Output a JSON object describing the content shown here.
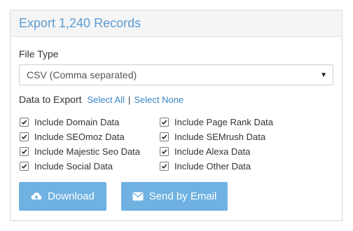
{
  "panel": {
    "title": "Export 1,240 Records"
  },
  "file_type": {
    "label": "File Type",
    "selected": "CSV (Comma separated)"
  },
  "data_to_export": {
    "label": "Data to Export",
    "select_all": "Select All",
    "separator": "|",
    "select_none": "Select None"
  },
  "options": [
    {
      "label": "Include Domain Data",
      "checked": true
    },
    {
      "label": "Include Page Rank Data",
      "checked": true
    },
    {
      "label": "Include SEOmoz Data",
      "checked": true
    },
    {
      "label": "Include SEMrush Data",
      "checked": true
    },
    {
      "label": "Include Majestic Seo Data",
      "checked": true
    },
    {
      "label": "Include Alexa Data",
      "checked": true
    },
    {
      "label": "Include Social Data",
      "checked": true
    },
    {
      "label": "Include Other Data",
      "checked": true
    }
  ],
  "buttons": {
    "download": {
      "label": "Download",
      "icon": "cloud-download-icon"
    },
    "email": {
      "label": "Send by Email",
      "icon": "envelope-icon"
    }
  },
  "colors": {
    "accent": "#5b9bd1",
    "button": "#6fb1e1",
    "link": "#3a87c8"
  }
}
